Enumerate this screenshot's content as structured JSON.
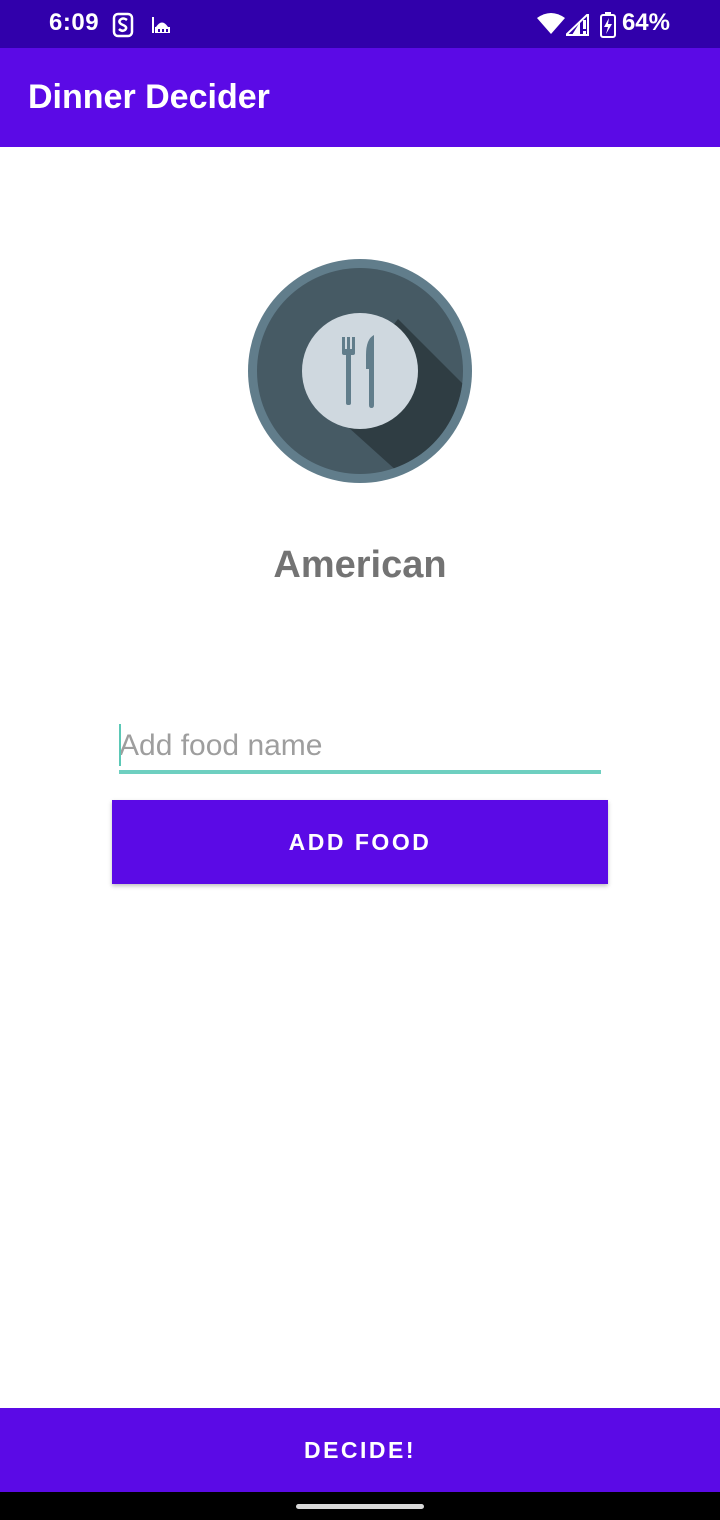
{
  "status_bar": {
    "time": "6:09",
    "battery": "64%",
    "icons": [
      "notification-s-icon",
      "mosque-icon",
      "wifi-icon",
      "signal-icon",
      "battery-charging-icon"
    ]
  },
  "app_bar": {
    "title": "Dinner Decider"
  },
  "main": {
    "image_icon": "plate-fork-knife-icon",
    "selected_food": "American",
    "input": {
      "value": "",
      "placeholder": "Add food name"
    },
    "add_button_label": "ADD FOOD"
  },
  "footer": {
    "decide_button_label": "DECIDE!"
  },
  "colors": {
    "status_bar": "#3100ab",
    "primary": "#5b0ae6",
    "accent": "#6ecfc0",
    "label_gray": "#737373"
  }
}
